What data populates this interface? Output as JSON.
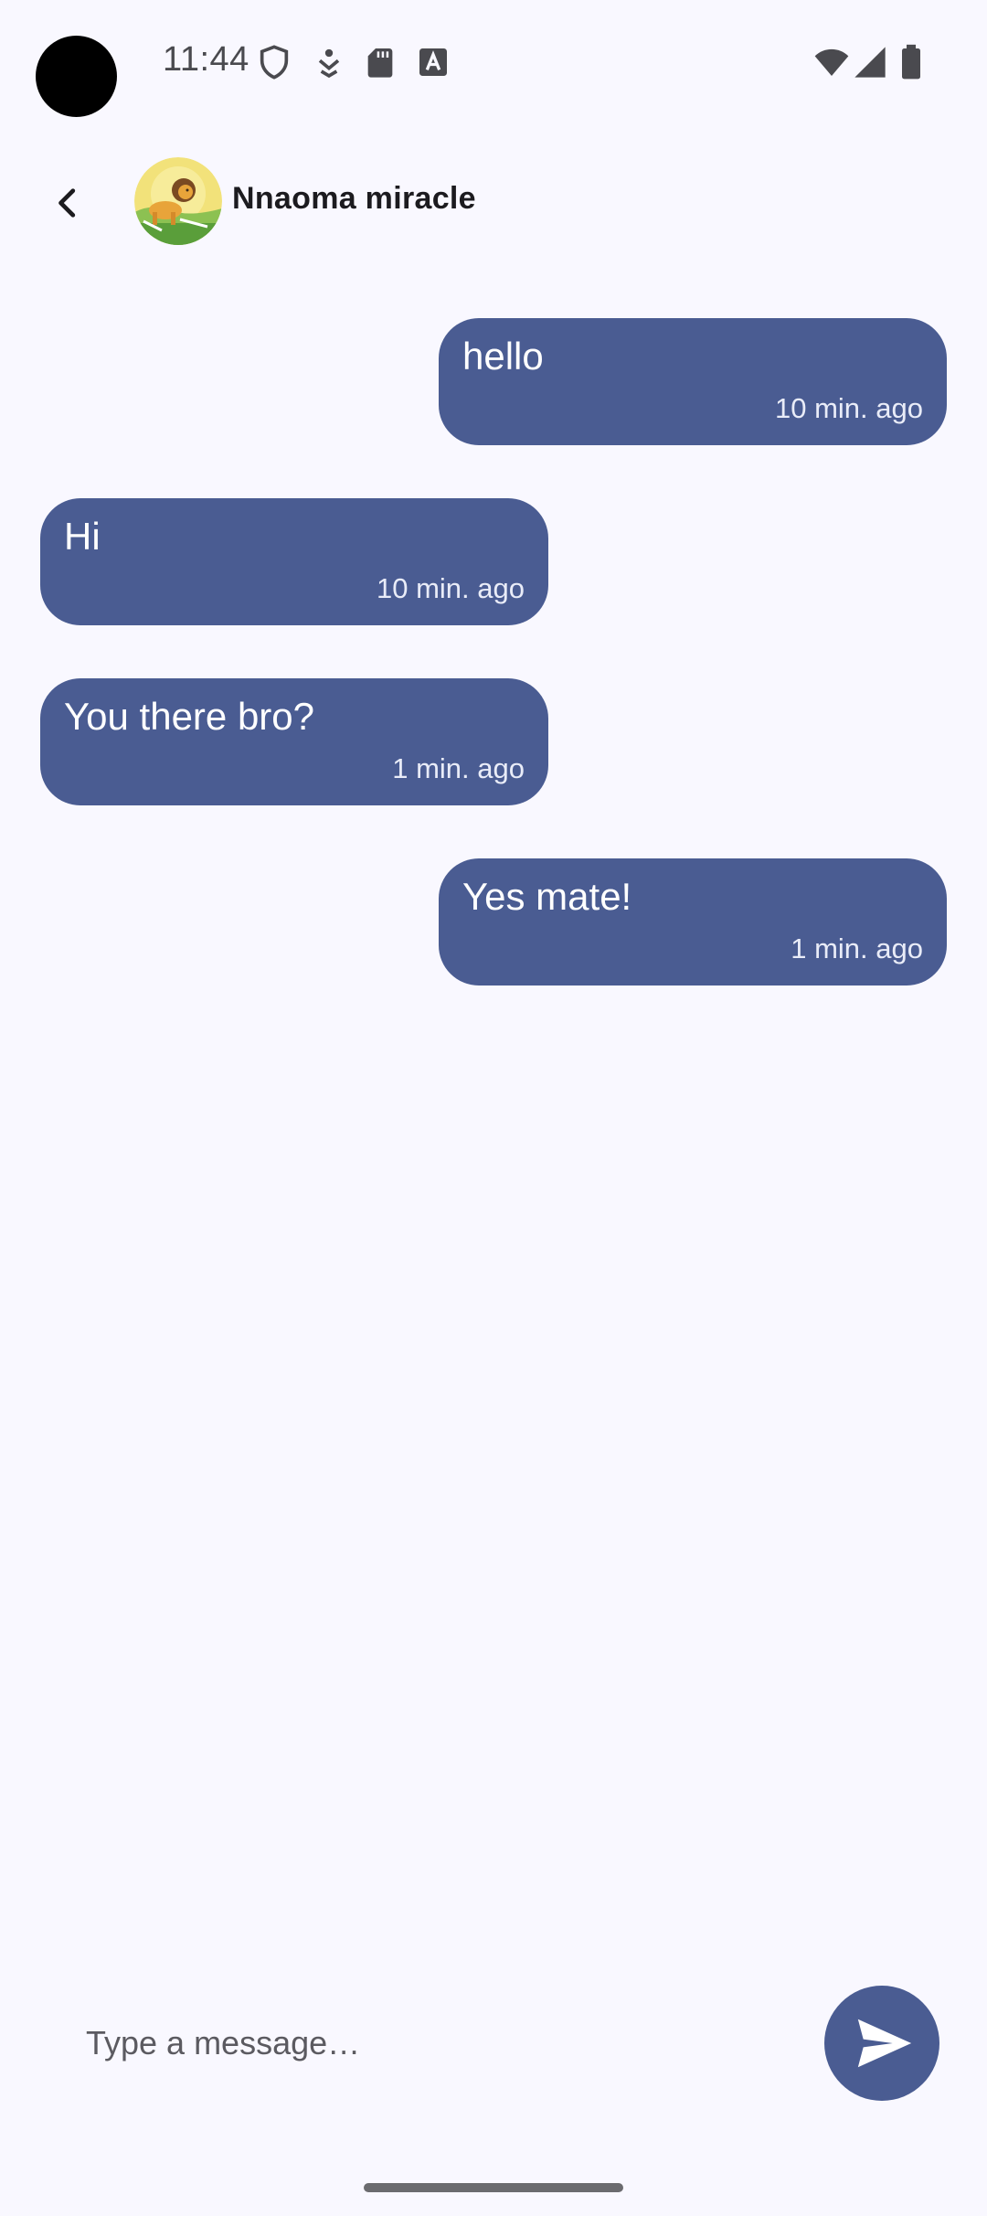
{
  "status_bar": {
    "time": "11:44",
    "icons": [
      "shield-icon",
      "download-icon",
      "sd-card-icon",
      "text-a-icon",
      "wifi-icon",
      "signal-icon",
      "battery-icon"
    ]
  },
  "app_bar": {
    "back_icon": "back-arrow-icon",
    "contact_name": "Nnaoma miracle",
    "avatar": "lion-avatar"
  },
  "messages": [
    {
      "text": "hello",
      "time": "10 min. ago",
      "side": "outgoing"
    },
    {
      "text": "Hi",
      "time": "10 min. ago",
      "side": "incoming"
    },
    {
      "text": "You there bro?",
      "time": "1 min. ago",
      "side": "incoming"
    },
    {
      "text": "Yes mate!",
      "time": "1 min. ago",
      "side": "outgoing"
    }
  ],
  "composer": {
    "placeholder": "Type a message…",
    "value": "",
    "send_icon": "send-icon"
  },
  "colors": {
    "background": "#f9f8ff",
    "bubble": "#4a5c92",
    "bubble_text": "#ffffff"
  }
}
